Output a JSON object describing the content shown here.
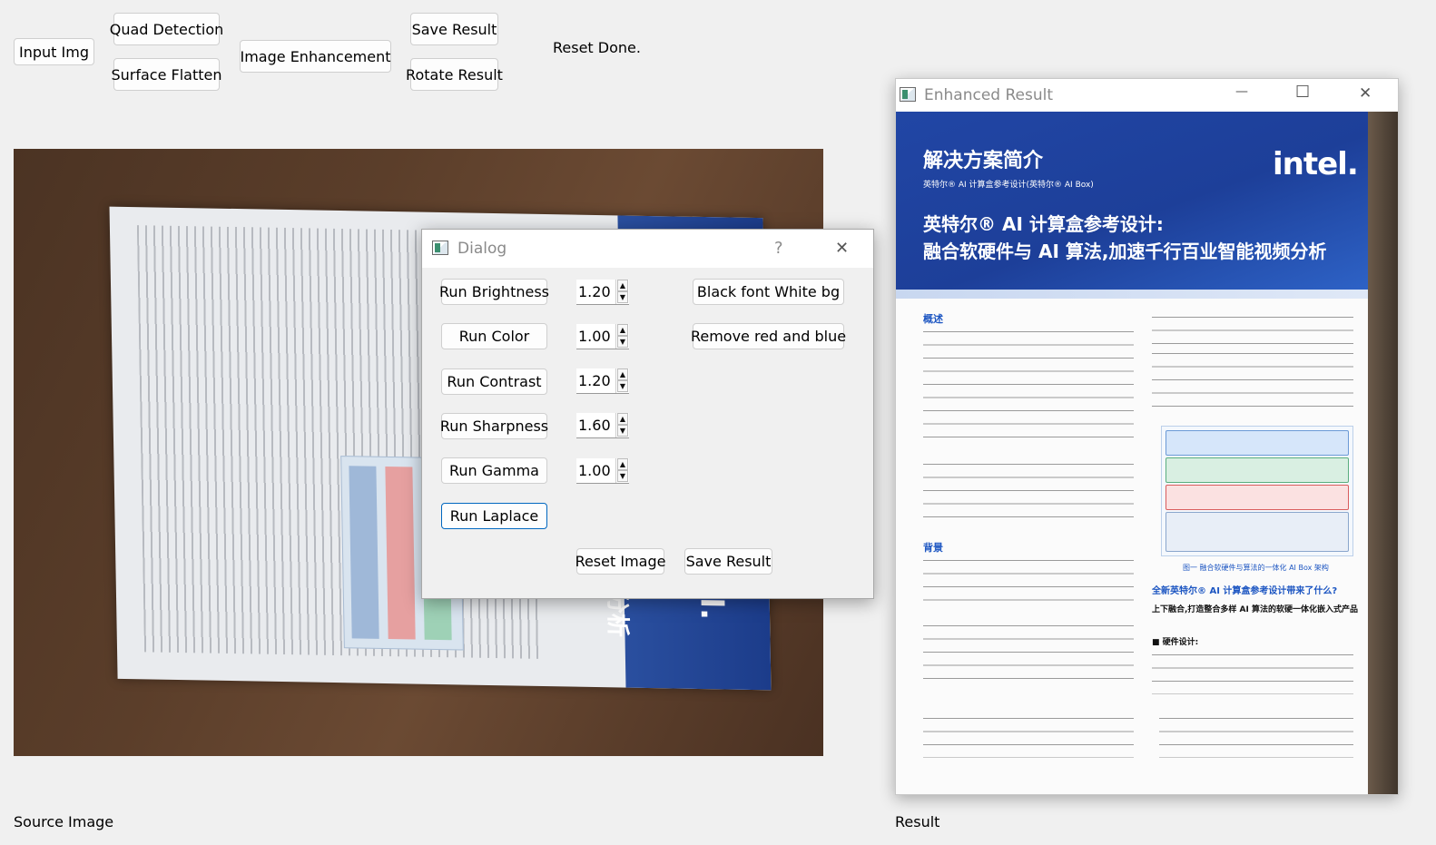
{
  "toolbar": {
    "input_img": "Input Img",
    "quad_detection": "Quad Detection",
    "surface_flatten": "Surface Flatten",
    "image_enhancement": "Image Enhancement",
    "save_result": "Save Result",
    "rotate_result": "Rotate Result",
    "status": "Reset Done."
  },
  "labels": {
    "source": "Source Image",
    "result": "Result"
  },
  "dialog": {
    "title": "Dialog",
    "help": "?",
    "close": "✕",
    "rows": [
      {
        "button": "Run Brightness",
        "value": "1.20"
      },
      {
        "button": "Run Color",
        "value": "1.00"
      },
      {
        "button": "Run Contrast",
        "value": "1.20"
      },
      {
        "button": "Run Sharpness",
        "value": "1.60"
      },
      {
        "button": "Run Gamma",
        "value": "1.00"
      }
    ],
    "laplace": "Run Laplace",
    "black_font": "Black font  White bg",
    "remove_red_blue": "Remove red and blue",
    "reset_image": "Reset Image",
    "save_result": "Save Result",
    "arrow_up": "▲",
    "arrow_down": "▼"
  },
  "result_window": {
    "title": "Enhanced Result",
    "minimize": "—",
    "maximize": "☐",
    "close": "✕"
  },
  "result_doc": {
    "heading": "解决方案简介",
    "subheading": "英特尔® AI 计算盒参考设计(英特尔® AI Box)",
    "logo": "intel.",
    "title_line1": "英特尔® AI 计算盒参考设计:",
    "title_line2": "融合软硬件与 AI 算法,加速千行百业智能视频分析",
    "sec_overview": "概述",
    "sec_background": "背景",
    "right_heading": "全新英特尔® AI 计算盒参考设计带来了什么?",
    "right_sub": "上下融合,打造整合多样 AI 算法的软硬一体化嵌入式产品",
    "hardware": "■ 硬件设计:",
    "caption": "图一 融合软硬件与算法的一体化 AI Box 架构"
  },
  "source_photo": {
    "mirrored_text": "el.",
    "mirrored_text2": "分析"
  },
  "colors": {
    "doc_blue": "#1d3f99",
    "accent_blue": "#1d56c2",
    "focus_blue": "#0067c0"
  }
}
